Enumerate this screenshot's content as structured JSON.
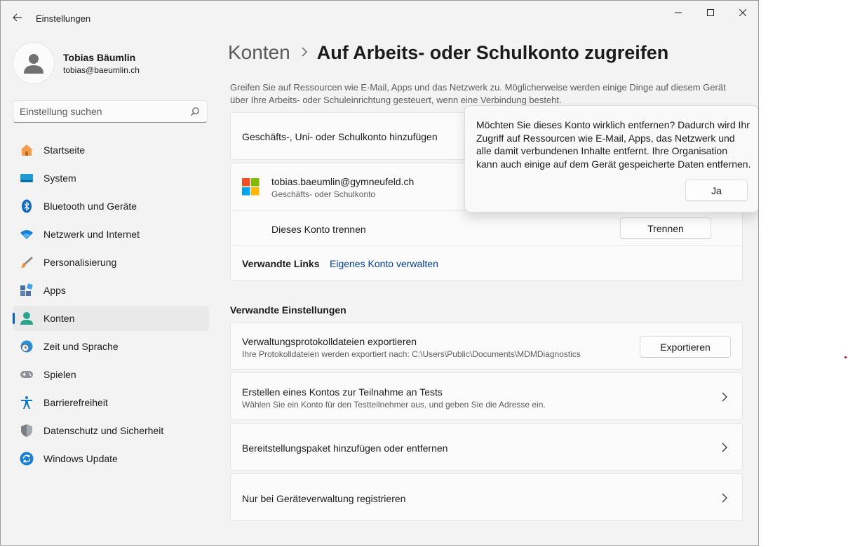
{
  "window": {
    "title": "Einstellungen"
  },
  "profile": {
    "name": "Tobias Bäumlin",
    "email": "tobias@baeumlin.ch"
  },
  "search": {
    "placeholder": "Einstellung suchen"
  },
  "nav": {
    "items": [
      {
        "label": "Startseite",
        "icon": "home-icon"
      },
      {
        "label": "System",
        "icon": "system-display-icon"
      },
      {
        "label": "Bluetooth und Geräte",
        "icon": "bluetooth-icon"
      },
      {
        "label": "Netzwerk und Internet",
        "icon": "wifi-icon"
      },
      {
        "label": "Personalisierung",
        "icon": "paintbrush-icon"
      },
      {
        "label": "Apps",
        "icon": "apps-icon"
      },
      {
        "label": "Konten",
        "icon": "accounts-icon",
        "active": true
      },
      {
        "label": "Zeit und Sprache",
        "icon": "globe-clock-icon"
      },
      {
        "label": "Spielen",
        "icon": "gamepad-icon"
      },
      {
        "label": "Barrierefreiheit",
        "icon": "accessibility-icon"
      },
      {
        "label": "Datenschutz und Sicherheit",
        "icon": "shield-icon"
      },
      {
        "label": "Windows Update",
        "icon": "windows-update-icon"
      }
    ]
  },
  "page": {
    "breadcrumb_parent": "Konten",
    "breadcrumb_current": "Auf Arbeits- oder Schulkonto zugreifen",
    "description": "Greifen Sie auf Ressourcen wie E-Mail, Apps und das Netzwerk zu. Möglicherweise werden einige Dinge auf diesem Gerät über Ihre Arbeits- oder Schuleinrichtung gesteuert, wenn eine Verbindung besteht."
  },
  "add_account": {
    "label": "Geschäfts-, Uni- oder Schulkonto hinzufügen"
  },
  "account": {
    "email": "tobias.baeumlin@gymneufeld.ch",
    "type": "Geschäfts- oder Schulkonto",
    "disconnect_label": "Dieses Konto trennen",
    "disconnect_button": "Trennen",
    "related_links_label": "Verwandte Links",
    "manage_link": "Eigenes Konto verwalten"
  },
  "related": {
    "title": "Verwandte Einstellungen",
    "export": {
      "title": "Verwaltungsprotokolldateien exportieren",
      "subtitle": "Ihre Protokolldateien werden exportiert nach: C:\\Users\\Public\\Documents\\MDMDiagnostics",
      "button": "Exportieren"
    },
    "test_account": {
      "title": "Erstellen eines Kontos zur Teilnahme an Tests",
      "subtitle": "Wählen Sie ein Konto für den Testteilnehmer aus, und geben Sie die Adresse ein."
    },
    "provisioning": {
      "title": "Bereitstellungspaket hinzufügen oder entfernen"
    },
    "enroll": {
      "title": "Nur bei Geräteverwaltung registrieren"
    }
  },
  "flyout": {
    "text": "Möchten Sie dieses Konto wirklich entfernen? Dadurch wird Ihr Zugriff auf Ressourcen wie E-Mail, Apps, das Netzwerk und alle damit verbundenen Inhalte entfernt. Ihre Organisation kann auch einige auf dem Gerät gespeicherte Daten entfernen.",
    "confirm": "Ja"
  },
  "colors": {
    "accent": "#005fb8",
    "link": "#003e92"
  }
}
